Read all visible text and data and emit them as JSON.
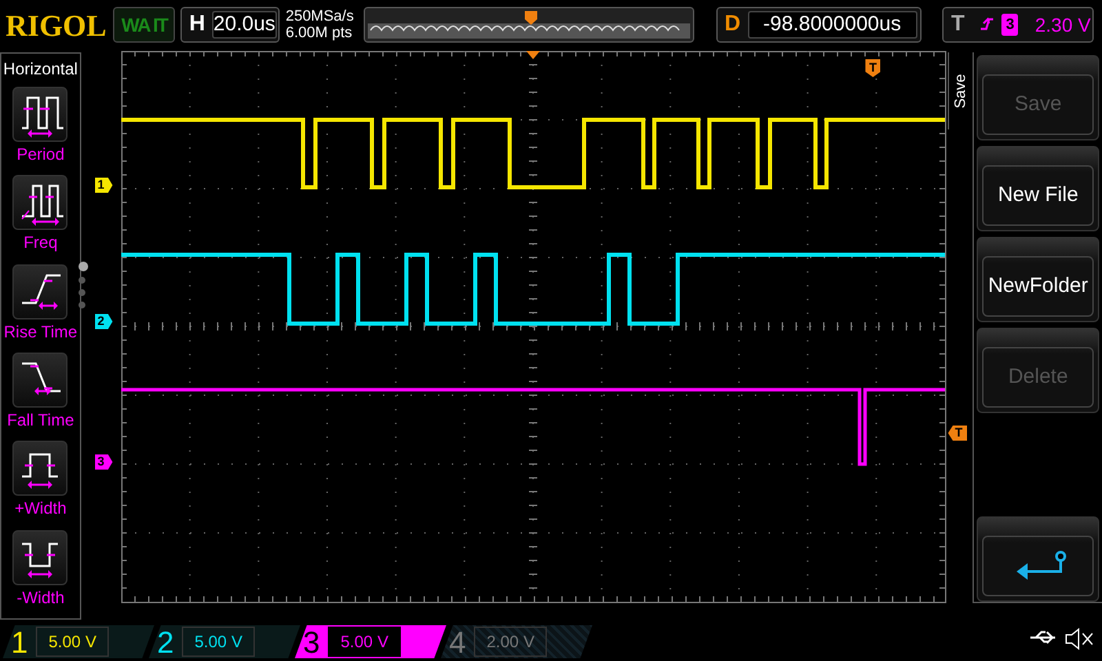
{
  "header": {
    "logo": "RIGOL",
    "run_status": "WA IT",
    "horizontal": {
      "label": "H",
      "timebase": "20.0us"
    },
    "sample_rate": "250MSa/s",
    "memory_depth": "6.00M pts",
    "delay": {
      "label": "D",
      "value": "-98.8000000us"
    },
    "trigger": {
      "label": "T",
      "source": "3",
      "level": "2.30 V"
    }
  },
  "left_menu": {
    "title": "Horizontal",
    "items": [
      {
        "kind": "period",
        "label": "Period"
      },
      {
        "kind": "freq",
        "label": "Freq"
      },
      {
        "kind": "rise",
        "label": "Rise Time"
      },
      {
        "kind": "fall",
        "label": "Fall Time"
      },
      {
        "kind": "pwidth",
        "label": "+Width"
      },
      {
        "kind": "nwidth",
        "label": "-Width"
      }
    ],
    "pages": [
      {
        "selected": true
      },
      {
        "selected": false
      },
      {
        "selected": false
      },
      {
        "selected": false
      }
    ]
  },
  "grid": {
    "markers": [
      {
        "label": "1",
        "color": "#f5e600"
      },
      {
        "label": "2",
        "color": "#00e1f0"
      },
      {
        "label": "3",
        "color": "#ff00ff"
      }
    ],
    "trigger_marker": "T",
    "level_marker": "T"
  },
  "right_menu": {
    "title": "Save",
    "buttons": [
      {
        "kind": "text",
        "label": "Save",
        "disabled": true
      },
      {
        "kind": "text",
        "label": "New File",
        "disabled": false
      },
      {
        "kind": "text",
        "label": "NewFolder",
        "disabled": false
      },
      {
        "kind": "text",
        "label": "Delete",
        "disabled": true
      },
      {
        "kind": "back"
      }
    ]
  },
  "channels": [
    {
      "number": "1",
      "scale": "5.00 V",
      "color": "#f5e600",
      "on": true,
      "selected": false
    },
    {
      "number": "2",
      "scale": "5.00 V",
      "color": "#00e1f0",
      "on": true,
      "selected": false
    },
    {
      "number": "3",
      "scale": "5.00 V",
      "color": "#ff00ff",
      "on": true,
      "selected": true
    },
    {
      "number": "4",
      "scale": "2.00 V",
      "color": "#808080",
      "on": false,
      "selected": false
    }
  ]
}
